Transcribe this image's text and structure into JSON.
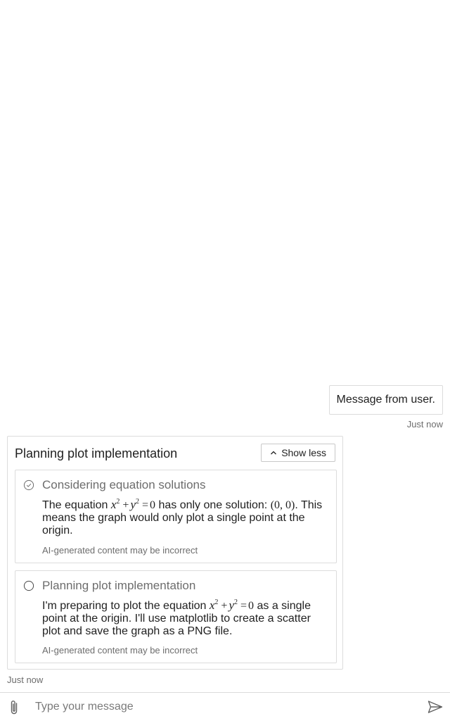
{
  "conversation": {
    "user_message": {
      "text": "Message from user.",
      "time": "Just now"
    },
    "assistant": {
      "card_title": "Planning plot implementation",
      "toggle_label": "Show less",
      "toggle_icon": "chevron-up-icon",
      "steps": [
        {
          "status": "completed",
          "icon": "check-circle-icon",
          "title": "Considering equation solutions",
          "body_prefix": "The equation ",
          "equation": "x² + y² = 0",
          "body_mid": " has only one solution: ",
          "solution": "(0, 0)",
          "body_suffix": ". This means the graph would only plot a single point at the origin.",
          "disclaimer": "AI-generated content may be incorrect"
        },
        {
          "status": "in-progress",
          "icon": "circle-icon",
          "title": "Planning plot implementation",
          "body_prefix": "I'm preparing to plot the equation ",
          "equation": "x² + y² = 0",
          "body_suffix": " as a single point at the origin. I'll use matplotlib to create a scatter plot and save the graph as a PNG file.",
          "disclaimer": "AI-generated content may be incorrect"
        }
      ],
      "time": "Just now"
    }
  },
  "composer": {
    "placeholder": "Type your message",
    "attach_icon": "paperclip-icon",
    "send_icon": "send-icon"
  },
  "colors": {
    "border": "#dcdcdc",
    "muted_text": "#6d6d6d",
    "text": "#1f1f1f"
  }
}
